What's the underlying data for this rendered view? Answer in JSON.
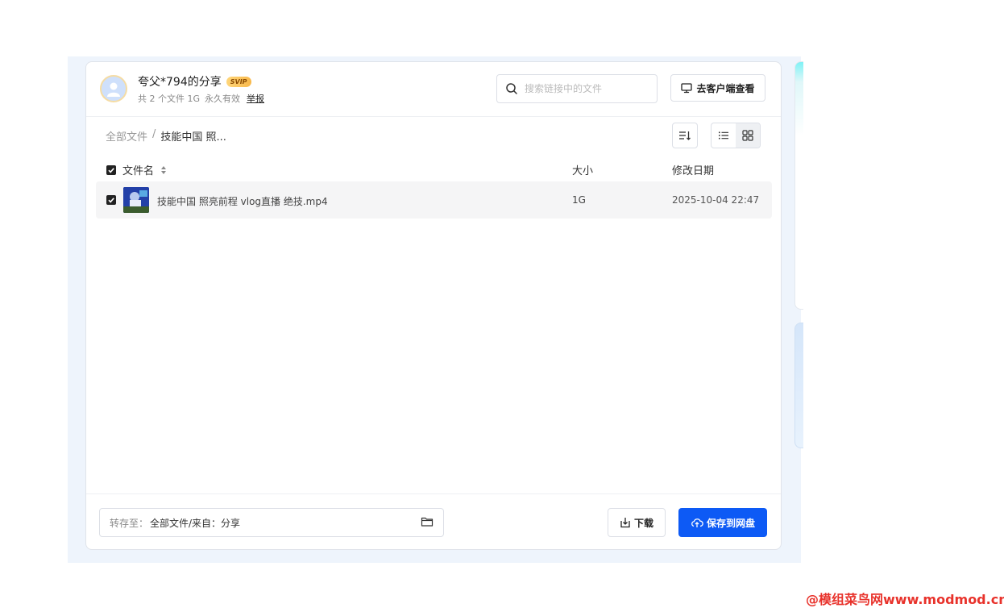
{
  "share": {
    "owner": "夸父*794的分享",
    "badge": "SVIP",
    "file_count": "共 2 个文件 1G",
    "validity": "永久有效",
    "report": "举报"
  },
  "search": {
    "placeholder": "搜索链接中的文件"
  },
  "client_button": {
    "label": "去客户端查看"
  },
  "breadcrumb": {
    "root": "全部文件",
    "separator": "/",
    "current": "技能中国 照..."
  },
  "table": {
    "headers": {
      "name": "文件名",
      "size": "大小",
      "date": "修改日期"
    },
    "rows": [
      {
        "name": "技能中国 照亮前程 vlog直播 绝技.mp4",
        "size": "1G",
        "date": "2025-10-04 22:47"
      }
    ]
  },
  "footer": {
    "save_to_label": "转存至：",
    "save_to_value": "全部文件/来自：分享",
    "download": "下载",
    "save": "保存到网盘"
  },
  "watermark": "@模组菜鸟网www.modmod.cn",
  "colors": {
    "primary": "#0d5af5",
    "watermark": "#e8322b"
  }
}
